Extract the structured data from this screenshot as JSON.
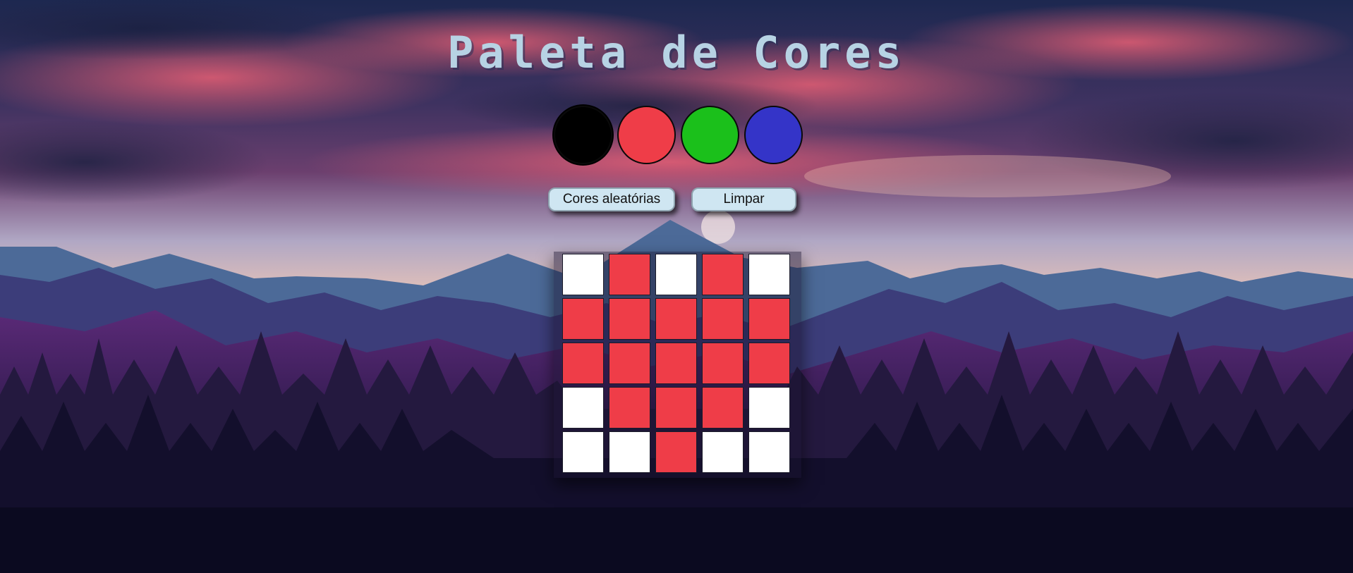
{
  "title": "Paleta de Cores",
  "palette": {
    "colors": [
      {
        "name": "black",
        "hex": "#000000",
        "selected": true
      },
      {
        "name": "red",
        "hex": "#ef3d48",
        "selected": false
      },
      {
        "name": "green",
        "hex": "#1bc01b",
        "selected": false
      },
      {
        "name": "blue",
        "hex": "#3434c8",
        "selected": false
      }
    ]
  },
  "buttons": {
    "random_label": "Cores aleatórias",
    "clear_label": "Limpar"
  },
  "board": {
    "size": 5,
    "colors": {
      "w": "#ffffff",
      "r": "#ef3d48"
    },
    "pixels": [
      [
        "w",
        "r",
        "w",
        "r",
        "w"
      ],
      [
        "r",
        "r",
        "r",
        "r",
        "r"
      ],
      [
        "r",
        "r",
        "r",
        "r",
        "r"
      ],
      [
        "w",
        "r",
        "r",
        "r",
        "w"
      ],
      [
        "w",
        "w",
        "r",
        "w",
        "w"
      ]
    ]
  }
}
